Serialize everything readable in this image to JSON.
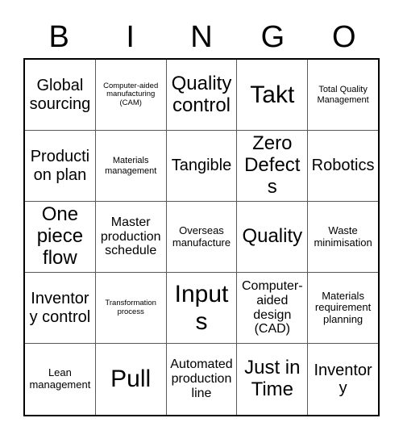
{
  "card": {
    "header_letters": [
      "B",
      "I",
      "N",
      "G",
      "O"
    ],
    "columns": 5,
    "rows": 5,
    "border_color": "#000000",
    "grid_line_color": "#58595b",
    "background_color": "#ffffff",
    "text_color": "#000000",
    "cells": [
      [
        {
          "label": "Global sourcing",
          "size": "lg"
        },
        {
          "label": "Computer-aided manufacturing (CAM)",
          "size": "xxs"
        },
        {
          "label": "Quality control",
          "size": "xl"
        },
        {
          "label": "Takt",
          "size": "xxl"
        },
        {
          "label": "Total Quality Management",
          "size": "xs"
        }
      ],
      [
        {
          "label": "Production plan",
          "size": "lg"
        },
        {
          "label": "Materials management",
          "size": "xs"
        },
        {
          "label": "Tangible",
          "size": "lg"
        },
        {
          "label": "Zero Defects",
          "size": "xl"
        },
        {
          "label": "Robotics",
          "size": "lg"
        }
      ],
      [
        {
          "label": "One piece flow",
          "size": "xl"
        },
        {
          "label": "Master production schedule",
          "size": "md"
        },
        {
          "label": "Overseas manufacture",
          "size": "sm"
        },
        {
          "label": "Quality",
          "size": "xl"
        },
        {
          "label": "Waste minimisation",
          "size": "sm"
        }
      ],
      [
        {
          "label": "Inventory control",
          "size": "lg"
        },
        {
          "label": "Transformation process",
          "size": "xxs"
        },
        {
          "label": "Inputs",
          "size": "xxl"
        },
        {
          "label": "Computer-aided design (CAD)",
          "size": "md"
        },
        {
          "label": "Materials requirement planning",
          "size": "sm"
        }
      ],
      [
        {
          "label": "Lean management",
          "size": "sm"
        },
        {
          "label": "Pull",
          "size": "xxl"
        },
        {
          "label": "Automated production line",
          "size": "md"
        },
        {
          "label": "Just in Time",
          "size": "xl"
        },
        {
          "label": "Inventory",
          "size": "lg"
        }
      ]
    ]
  }
}
